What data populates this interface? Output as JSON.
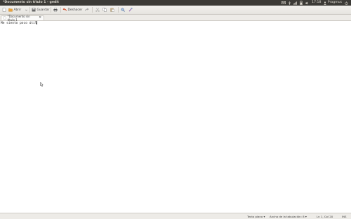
{
  "window": {
    "title": "*Documento sin título 1 - gedit"
  },
  "panel": {
    "time": "17:18",
    "user": "Pragmus",
    "icons": [
      "mail-icon",
      "bluetooth-icon",
      "network-icon",
      "battery-icon",
      "volume-icon",
      "clock",
      "user-icon",
      "power-icon"
    ]
  },
  "toolbar": {
    "new_label": "",
    "open_label": "Abrir",
    "save_label": "Guardar",
    "print_label": "",
    "undo_label": "Deshacer"
  },
  "tabs": [
    {
      "label": "*Documento sin título 1"
    }
  ],
  "editor": {
    "text": "Me siento poco útil"
  },
  "statusbar": {
    "syntax": "Texto plano",
    "tab_width": "Ancho de la tabulación: 8",
    "position": "Ln 1, Col 20",
    "mode": "INS"
  },
  "colors": {
    "panel_bg": "#3c3b37",
    "close_button": "#e0562c",
    "toolbar_bg": "#eceae6",
    "editor_bg": "#ffffff"
  }
}
